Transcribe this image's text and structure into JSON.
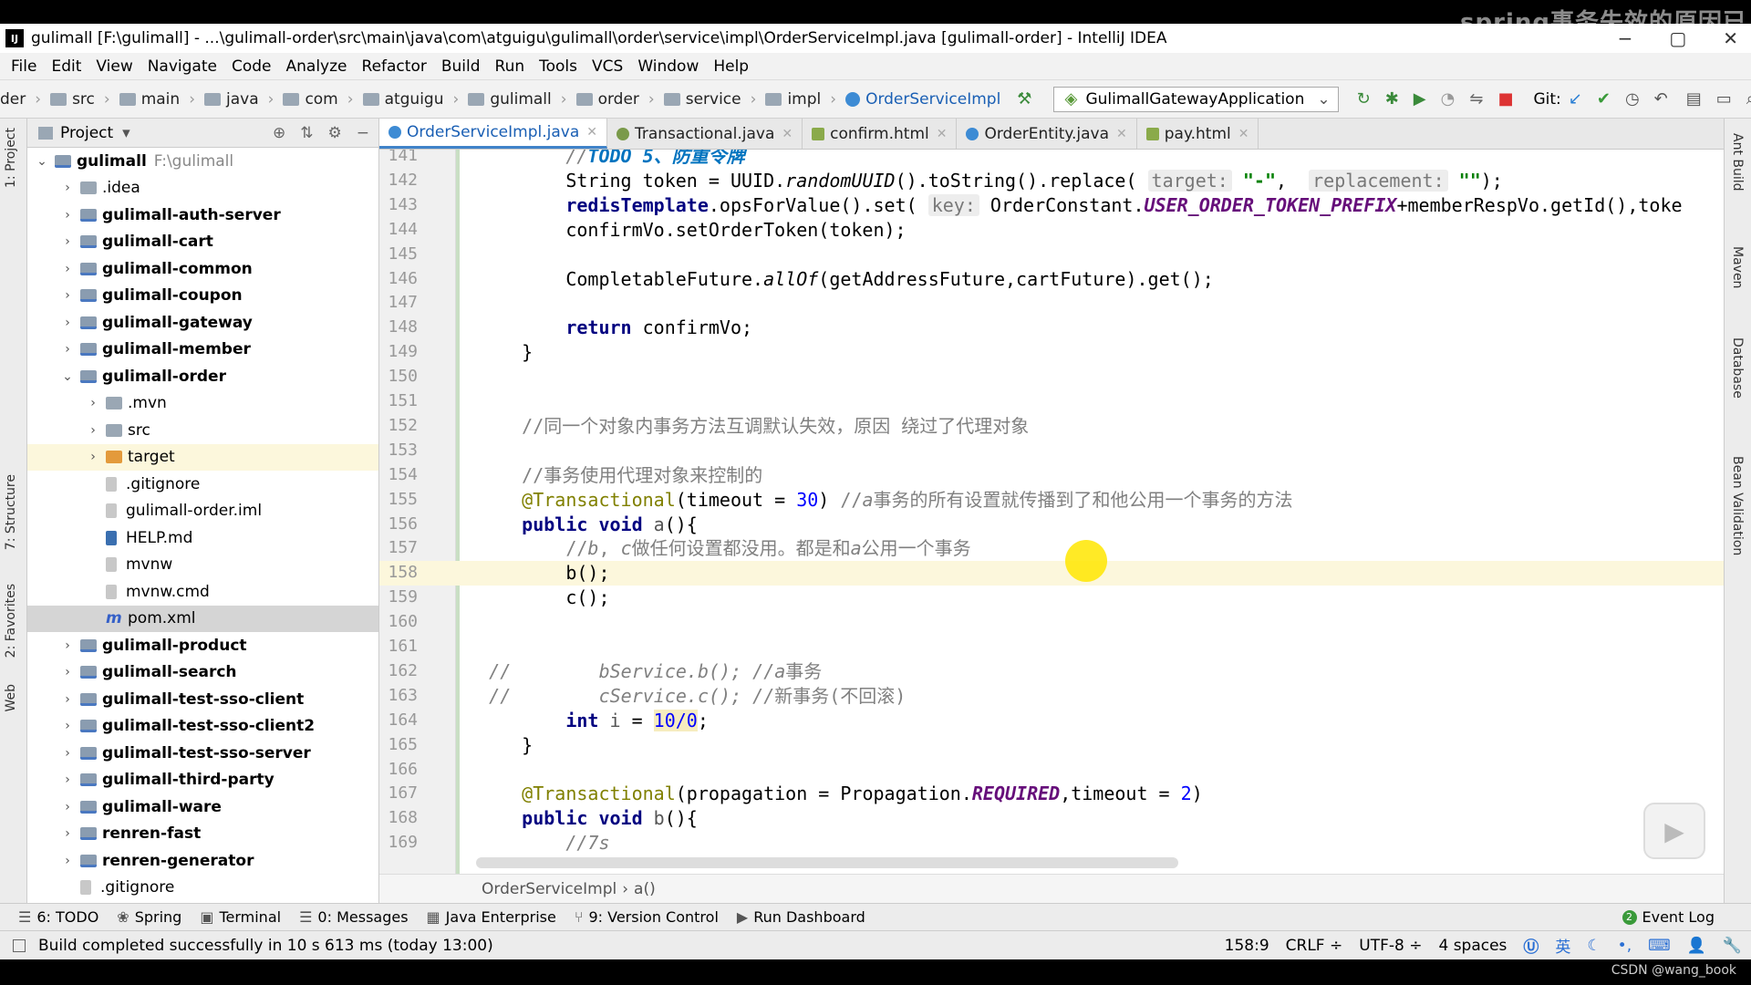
{
  "window": {
    "title": "gulimall [F:\\gulimall] - ...\\gulimall-order\\src\\main\\java\\com\\atguigu\\gulimall\\order\\service\\impl\\OrderServiceImpl.java [gulimall-order] - IntelliJ IDEA",
    "watermark": "spring事务失效的原因已",
    "logo": "IJ"
  },
  "menu": [
    "File",
    "Edit",
    "View",
    "Navigate",
    "Code",
    "Analyze",
    "Refactor",
    "Build",
    "Run",
    "Tools",
    "VCS",
    "Window",
    "Help"
  ],
  "breadcrumbs": [
    "der",
    "src",
    "main",
    "java",
    "com",
    "atguigu",
    "gulimall",
    "order",
    "service",
    "impl",
    "OrderServiceImpl"
  ],
  "run_config": "GulimallGatewayApplication",
  "git_label": "Git:",
  "left_strip": [
    "1: Project",
    "7: Structure",
    "2: Favorites",
    "Web"
  ],
  "right_strip": [
    "Ant Build",
    "Maven",
    "Database",
    "Bean Validation"
  ],
  "project": {
    "header": "Project",
    "tree": [
      {
        "label": "gulimall",
        "path": "F:\\gulimall",
        "depth": 0,
        "arrow": "⌄",
        "icon": "mod",
        "bold": true
      },
      {
        "label": ".idea",
        "depth": 1,
        "arrow": "›",
        "icon": "folder"
      },
      {
        "label": "gulimall-auth-server",
        "depth": 1,
        "arrow": "›",
        "icon": "mod",
        "bold": true
      },
      {
        "label": "gulimall-cart",
        "depth": 1,
        "arrow": "›",
        "icon": "mod",
        "bold": true
      },
      {
        "label": "gulimall-common",
        "depth": 1,
        "arrow": "›",
        "icon": "mod",
        "bold": true
      },
      {
        "label": "gulimall-coupon",
        "depth": 1,
        "arrow": "›",
        "icon": "mod",
        "bold": true
      },
      {
        "label": "gulimall-gateway",
        "depth": 1,
        "arrow": "›",
        "icon": "mod",
        "bold": true
      },
      {
        "label": "gulimall-member",
        "depth": 1,
        "arrow": "›",
        "icon": "mod",
        "bold": true
      },
      {
        "label": "gulimall-order",
        "depth": 1,
        "arrow": "⌄",
        "icon": "mod",
        "bold": true
      },
      {
        "label": ".mvn",
        "depth": 2,
        "arrow": "›",
        "icon": "folder"
      },
      {
        "label": "src",
        "depth": 2,
        "arrow": "›",
        "icon": "folder"
      },
      {
        "label": "target",
        "depth": 2,
        "arrow": "›",
        "icon": "orange",
        "hl": true
      },
      {
        "label": ".gitignore",
        "depth": 2,
        "arrow": "",
        "icon": "file"
      },
      {
        "label": "gulimall-order.iml",
        "depth": 2,
        "arrow": "",
        "icon": "file"
      },
      {
        "label": "HELP.md",
        "depth": 2,
        "arrow": "",
        "icon": "md"
      },
      {
        "label": "mvnw",
        "depth": 2,
        "arrow": "",
        "icon": "file"
      },
      {
        "label": "mvnw.cmd",
        "depth": 2,
        "arrow": "",
        "icon": "file"
      },
      {
        "label": "pom.xml",
        "depth": 2,
        "arrow": "",
        "icon": "m",
        "sel": true
      },
      {
        "label": "gulimall-product",
        "depth": 1,
        "arrow": "›",
        "icon": "mod",
        "bold": true
      },
      {
        "label": "gulimall-search",
        "depth": 1,
        "arrow": "›",
        "icon": "mod",
        "bold": true
      },
      {
        "label": "gulimall-test-sso-client",
        "depth": 1,
        "arrow": "›",
        "icon": "mod",
        "bold": true
      },
      {
        "label": "gulimall-test-sso-client2",
        "depth": 1,
        "arrow": "›",
        "icon": "mod",
        "bold": true
      },
      {
        "label": "gulimall-test-sso-server",
        "depth": 1,
        "arrow": "›",
        "icon": "mod",
        "bold": true
      },
      {
        "label": "gulimall-third-party",
        "depth": 1,
        "arrow": "›",
        "icon": "mod",
        "bold": true
      },
      {
        "label": "gulimall-ware",
        "depth": 1,
        "arrow": "›",
        "icon": "mod",
        "bold": true
      },
      {
        "label": "renren-fast",
        "depth": 1,
        "arrow": "›",
        "icon": "mod",
        "bold": true
      },
      {
        "label": "renren-generator",
        "depth": 1,
        "arrow": "›",
        "icon": "mod",
        "bold": true
      },
      {
        "label": ".gitignore",
        "depth": 1,
        "arrow": "",
        "icon": "file"
      }
    ]
  },
  "tabs": [
    {
      "label": "OrderServiceImpl.java",
      "active": true,
      "kind": "class"
    },
    {
      "label": "Transactional.java",
      "kind": "anno"
    },
    {
      "label": "confirm.html",
      "kind": "html"
    },
    {
      "label": "OrderEntity.java",
      "kind": "class"
    },
    {
      "label": "pay.html",
      "kind": "html"
    }
  ],
  "code_lines": [
    {
      "n": "141",
      "html": "    <span class=\"cm\">//</span><span class=\"todo\">TODO 5、防重令牌</span>"
    },
    {
      "n": "142",
      "html": "    String token = UUID.<span class=\"ital\">randomUUID</span>().toString().replace( <span class=\"hint\">target:</span> <span class=\"st\">\"-\"</span>,  <span class=\"hint\">replacement:</span> <span class=\"st\">\"\"</span>);"
    },
    {
      "n": "143",
      "html": "    <span class=\"kw\">redisTemplate</span>.opsForValue().set( <span class=\"hint\">key:</span> OrderConstant.<span class=\"const\">USER_ORDER_TOKEN_PREFIX</span>+memberRespVo.getId(),toke"
    },
    {
      "n": "144",
      "html": "    confirmVo.setOrderToken(token);"
    },
    {
      "n": "145",
      "html": ""
    },
    {
      "n": "146",
      "html": "    CompletableFuture.<span class=\"ital\">allOf</span>(getAddressFuture,cartFuture).get();"
    },
    {
      "n": "147",
      "html": ""
    },
    {
      "n": "148",
      "html": "    <span class=\"kw\">return</span> confirmVo;"
    },
    {
      "n": "149",
      "html": "}"
    },
    {
      "n": "150",
      "html": ""
    },
    {
      "n": "151",
      "html": ""
    },
    {
      "n": "152",
      "html": "<span class=\"cmz\">//同一个对象内事务方法互调默认失效，原因 绕过了代理对象</span>"
    },
    {
      "n": "153",
      "html": ""
    },
    {
      "n": "154",
      "html": "<span class=\"cmz\">//事务使用代理对象来控制的</span>"
    },
    {
      "n": "155",
      "html": "<span class=\"an\">@Transactional</span>(timeout = <span class=\"num\">30</span>) <span class=\"cmz\">//<i>a</i>事务的所有设置就传播到了和他公用一个事务的方法</span>"
    },
    {
      "n": "156",
      "html": "<span class=\"kw\">public void</span> <span class=\"par\">a</span>(){"
    },
    {
      "n": "157",
      "html": "    <span class=\"cmz\">//<i>b</i>, <i>c</i>做任何设置都没用。都是和<i>a</i>公用一个事务</span>"
    },
    {
      "n": "158",
      "html": "    b();",
      "cur": true
    },
    {
      "n": "159",
      "html": "    c();"
    },
    {
      "n": "160",
      "html": ""
    },
    {
      "n": "161",
      "html": ""
    },
    {
      "n": "162",
      "html": "<span class=\"cm\">//        bService.b(); //</span><span class=\"cmz\"><i>a</i>事务</span>",
      "pre": "-3"
    },
    {
      "n": "163",
      "html": "<span class=\"cm\">//        cService.c(); //</span><span class=\"cmz\">新事务(不回滚)</span>",
      "pre": "-3"
    },
    {
      "n": "164",
      "html": "    <span class=\"kw\">int</span> <span class=\"par\">i</span> = <span class=\"numhl\">10/0</span>;"
    },
    {
      "n": "165",
      "html": "}"
    },
    {
      "n": "166",
      "html": ""
    },
    {
      "n": "167",
      "html": "<span class=\"an\">@Transactional</span>(propagation = Propagation.<span class=\"const\">REQUIRED</span>,timeout = <span class=\"num\">2</span>)"
    },
    {
      "n": "168",
      "html": "<span class=\"kw\">public void</span> <span class=\"par\">b</span>(){"
    },
    {
      "n": "169",
      "html": "    <span class=\"cm\">//7s</span>"
    }
  ],
  "editor_breadcrumb": [
    "OrderServiceImpl",
    "a()"
  ],
  "tool_windows": [
    {
      "label": "6: TODO",
      "icon": "☰"
    },
    {
      "label": "Spring",
      "icon": "❀"
    },
    {
      "label": "Terminal",
      "icon": "▣"
    },
    {
      "label": "0: Messages",
      "icon": "☰"
    },
    {
      "label": "Java Enterprise",
      "icon": "▦"
    },
    {
      "label": "9: Version Control",
      "icon": "⑂"
    },
    {
      "label": "Run Dashboard",
      "icon": "▶"
    }
  ],
  "event_log": "Event Log",
  "status": {
    "message": "Build completed successfully in 10 s 613 ms (today 13:00)",
    "position": "158:9",
    "line_sep": "CRLF ÷",
    "encoding": "UTF-8 ÷",
    "indent": "4 spaces",
    "ime": "英"
  },
  "footer_credit": "CSDN @wang_book"
}
